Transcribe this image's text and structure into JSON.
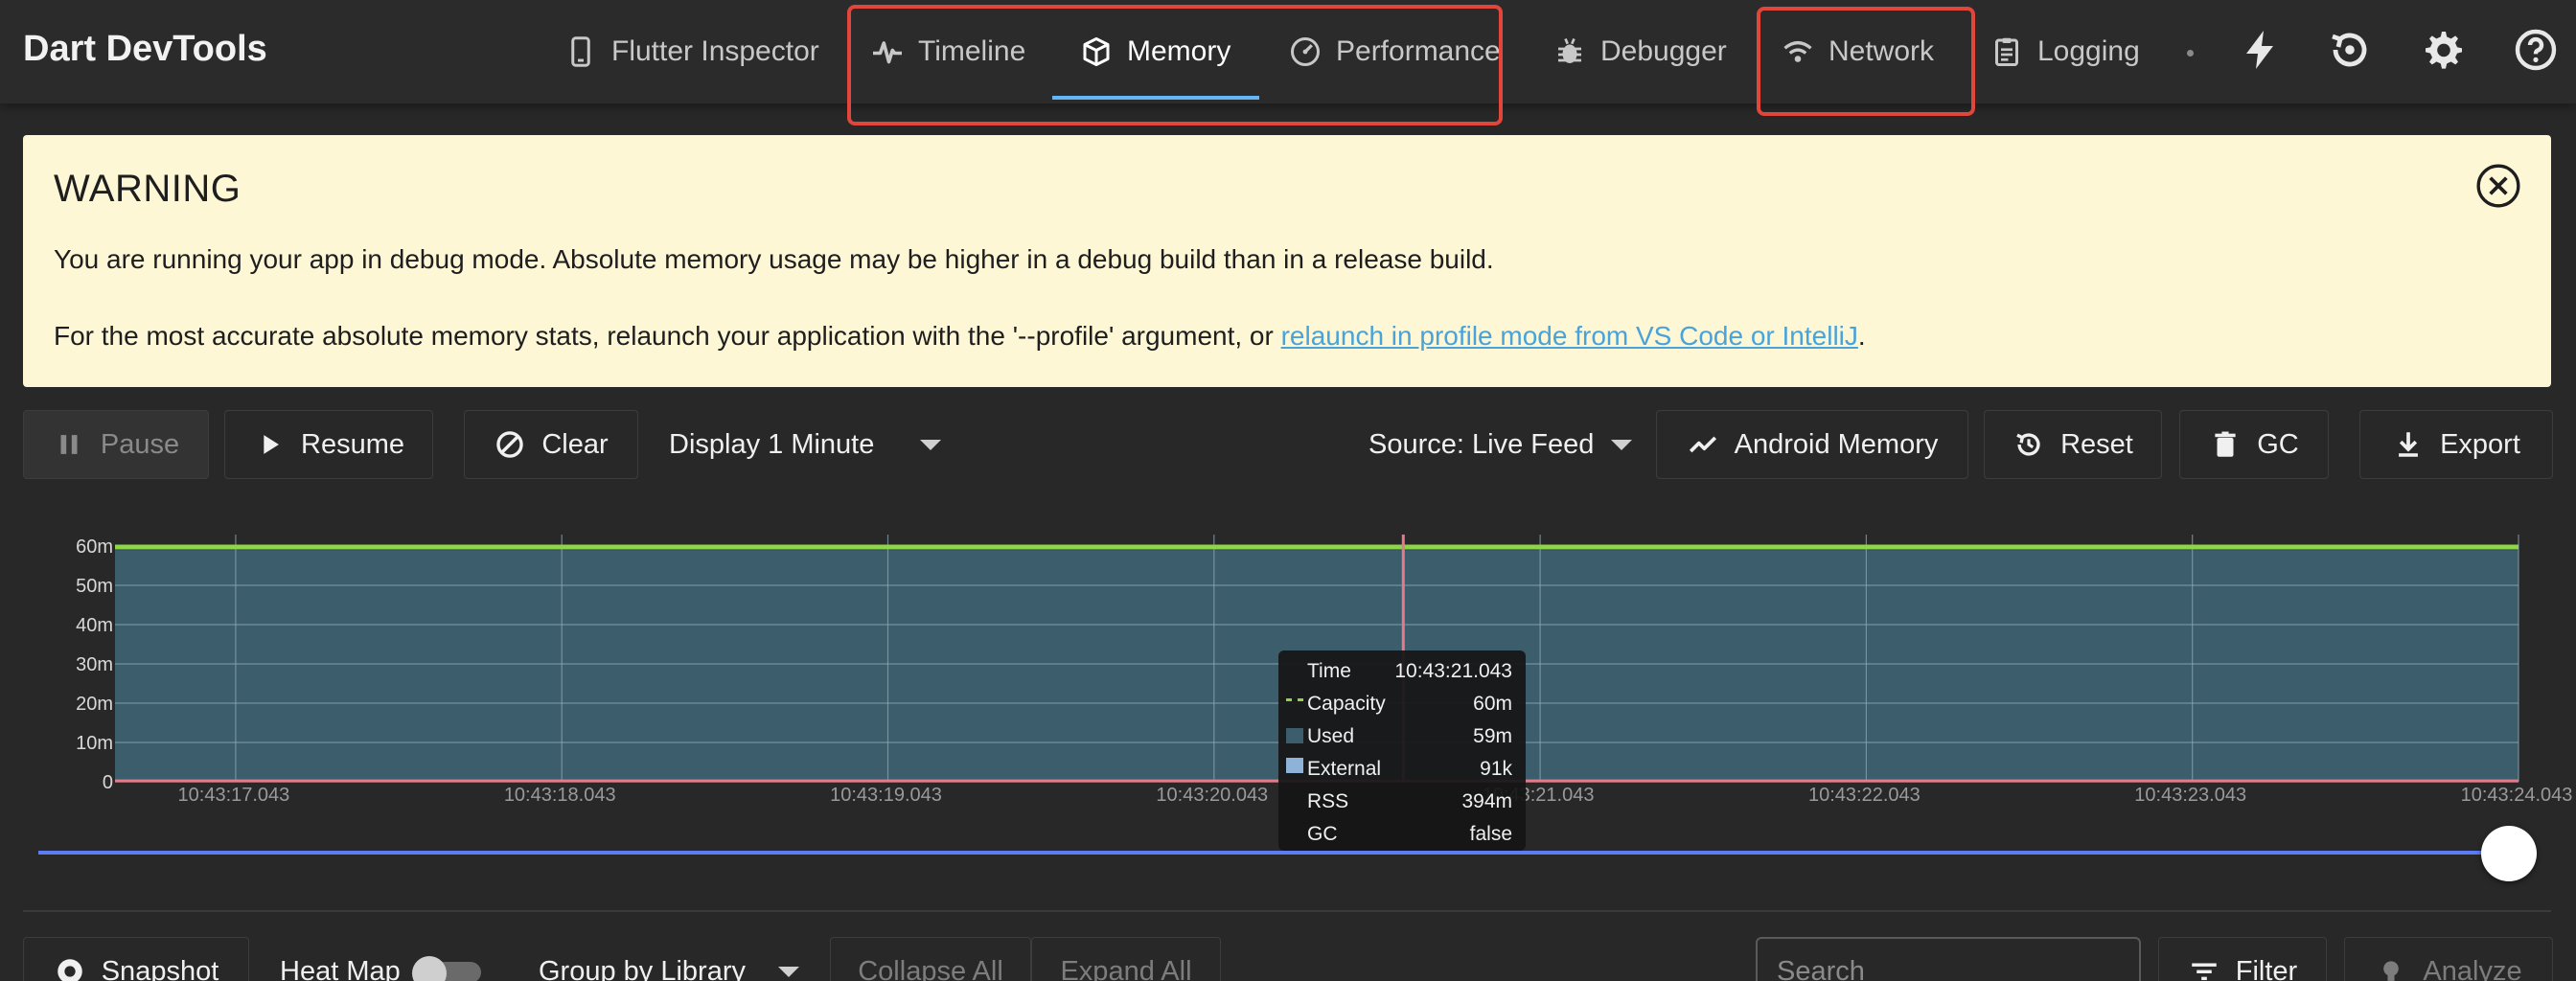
{
  "app": {
    "title": "Dart DevTools"
  },
  "nav": {
    "tabs": [
      {
        "id": "flutter_inspector",
        "label": "Flutter Inspector",
        "icon": "phone-icon"
      },
      {
        "id": "timeline",
        "label": "Timeline",
        "icon": "pulse-icon"
      },
      {
        "id": "memory",
        "label": "Memory",
        "icon": "box-icon",
        "active": true
      },
      {
        "id": "performance",
        "label": "Performance",
        "icon": "gauge-icon"
      },
      {
        "id": "debugger",
        "label": "Debugger",
        "icon": "bug-icon"
      },
      {
        "id": "network",
        "label": "Network",
        "icon": "wifi-icon"
      },
      {
        "id": "logging",
        "label": "Logging",
        "icon": "clipboard-icon"
      }
    ],
    "actions": [
      "bolt-icon",
      "history-icon",
      "gear-icon",
      "help-icon"
    ],
    "highlight_color": "#e2453a",
    "active_color": "#62b6f7"
  },
  "warning": {
    "title": "WARNING",
    "line1": "You are running your app in debug mode. Absolute memory usage may be higher in a debug build than in a release build.",
    "line2_prefix": "For the most accurate absolute memory stats, relaunch your application with the '--profile' argument, or ",
    "line2_link": "relaunch in profile mode from VS Code or IntelliJ",
    "line2_suffix": ".",
    "background": "#fdf7d6",
    "link_color": "#4aa3d8"
  },
  "toolbar": {
    "pause_label": "Pause",
    "resume_label": "Resume",
    "clear_label": "Clear",
    "display_label": "Display 1 Minute",
    "source_label": "Source: Live Feed",
    "android_memory_label": "Android Memory",
    "reset_label": "Reset",
    "gc_label": "GC",
    "export_label": "Export"
  },
  "chart_data": {
    "type": "area",
    "y_ticks": [
      "0",
      "10m",
      "20m",
      "30m",
      "40m",
      "50m",
      "60m"
    ],
    "ylim": [
      0,
      60
    ],
    "x_ticks": [
      "10:43:17.043",
      "10:43:18.043",
      "10:43:19.043",
      "10:43:20.043",
      "10:43:21.043",
      "10:43:22.043",
      "10:43:23.043",
      "10:43:24.043"
    ],
    "grid": true,
    "series": [
      {
        "name": "Capacity",
        "style": "dashed-line",
        "color": "#8ed548",
        "value": 60
      },
      {
        "name": "Used",
        "style": "area",
        "color": "#3b5d6c",
        "value": 59
      },
      {
        "name": "External",
        "style": "area",
        "color": "#8fb3d8",
        "value": 0.091
      }
    ],
    "rss_line_color": "#e57a8a",
    "selection_line_color": "#e57a8a",
    "selected_time": "10:43:21.043",
    "selected_x_fraction": 0.536
  },
  "tooltip": {
    "rows": [
      {
        "label": "Time",
        "value": "10:43:21.043"
      },
      {
        "label": "Capacity",
        "value": "60m"
      },
      {
        "label": "Used",
        "value": "59m"
      },
      {
        "label": "External",
        "value": "91k"
      },
      {
        "label": "RSS",
        "value": "394m"
      },
      {
        "label": "GC",
        "value": "false"
      }
    ]
  },
  "bottom": {
    "snapshot_label": "Snapshot",
    "heatmap_label": "Heat Map",
    "heatmap_on": false,
    "group_label": "Group by Library",
    "collapse_label": "Collapse All",
    "expand_label": "Expand All",
    "search_placeholder": "Search",
    "filter_label": "Filter",
    "analyze_label": "Analyze"
  }
}
